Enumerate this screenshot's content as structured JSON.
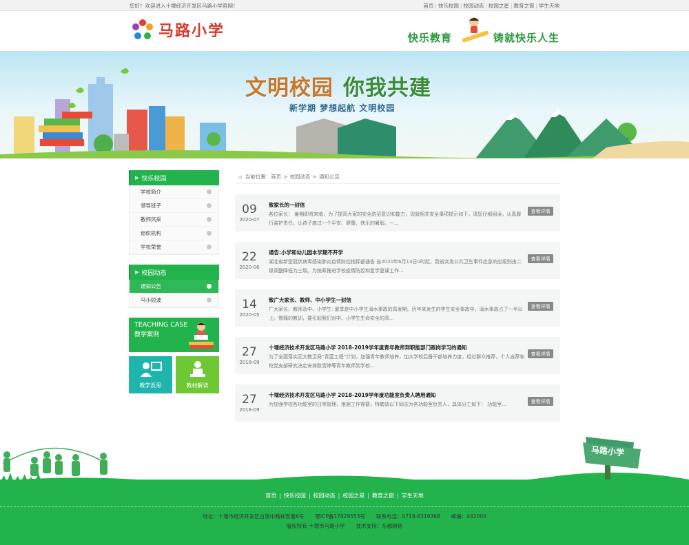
{
  "topbar": {
    "welcome": "您好！欢迎进入十堰经济开发区马路小学官网！",
    "nav": [
      "首页",
      "快乐校园",
      "校园动态",
      "校园之星",
      "教育之窗",
      "学生天地"
    ]
  },
  "header": {
    "logo_text": "马路小学",
    "slogan_left": "快乐教育",
    "slogan_right": "铸就快乐人生"
  },
  "banner": {
    "title_a": "文明校园",
    "title_b": "你我共建",
    "subtitle": "新学期 梦想起航 文明校园"
  },
  "sidebar": {
    "sections": [
      {
        "title": "快乐校园",
        "items": [
          "学校简介",
          "领导班子",
          "教师风采",
          "组织机构",
          "学校荣誉"
        ]
      },
      {
        "title": "校园动态",
        "items": [
          "通知公告",
          "马小短波"
        ]
      }
    ],
    "active_item": "通知公告",
    "teaching_en": "TEACHING CASE",
    "teaching_cn": "教学案例",
    "tile_1": "教学反思",
    "tile_2": "教材解读"
  },
  "breadcrumb": {
    "label": "当前位置：",
    "path": [
      "首页",
      "校园动态",
      "通知公告"
    ]
  },
  "news": [
    {
      "day": "09",
      "ym": "2020-07",
      "title": "致家长的一封信",
      "desc": "各位家长：  暑期即将来临，为了提高大家的安全防范意识和能力，现就相关安全事项提示如下，请您仔细阅读，认真履行监护责任，让孩子度过一个平安、健康、快乐的暑假。一...",
      "btn": "查看详情"
    },
    {
      "day": "22",
      "ym": "2020-06",
      "title": "通告:小学和幼儿园本学期不开学",
      "desc": "湖北省新型冠状病毒感染肺炎疫情防控指挥部通告 自2020年6月13日0时起，我省突发公共卫生事件应急响应级别由二级调整降低为三级。为统筹推进学校疫情防控和复学复课工作...",
      "btn": "查看详情"
    },
    {
      "day": "14",
      "ym": "2020-05",
      "title": "致广大家长、教师、中小学生一封信",
      "desc": "广大家长、教师及中、小学生: 夏季是中小学生溺水事故的高发期。历年来发生的学生安全事故中，溺水事故占了一半以上。惨痛的教训，要引起我们对中、小学生生命安全的高...",
      "btn": "查看详情"
    },
    {
      "day": "27",
      "ym": "2018-09",
      "title": "十堰经济技术开发区马路小学 2018-2019学年度青年教师到职能部门跟岗学习的通知",
      "desc": "为了全面落实区文教卫局“青蓝工程”计划，加强青年教师培养，加大学校后备干部培养力度，经过群众推荐，个人自荐和校党支部研究决定安排数雪婷等青年教师到学校...",
      "btn": "查看详情"
    },
    {
      "day": "27",
      "ym": "2018-09",
      "title": "十堰经济技术开发区马路小学 2018-2019学年度功能室负责人聘用通知",
      "desc": "为加强学校各功能室的日常管理，根据工作需要，特聘请以下同志为各功能室负责人，具体分工如下： 功能室...",
      "btn": "查看详情"
    }
  ],
  "footer": {
    "sign_text": "马路小学",
    "nav": [
      "首页",
      "快乐校园",
      "校园动态",
      "校园之星",
      "教育之窗",
      "学生天地"
    ],
    "address": "地址：十堰市经济开发区白浪中路祥安巷6号",
    "icp": "鄂ICP备17029553号",
    "phone": "联系电话：0719-8319368",
    "postcode": "邮编：442000",
    "copyright": "版权所有 十堰市马路小学",
    "support": "技术支持：东都网络"
  },
  "colors": {
    "green": "#23b34d",
    "teal": "#1fb5ad",
    "lime": "#6ec833",
    "button_gray": "#888888"
  }
}
